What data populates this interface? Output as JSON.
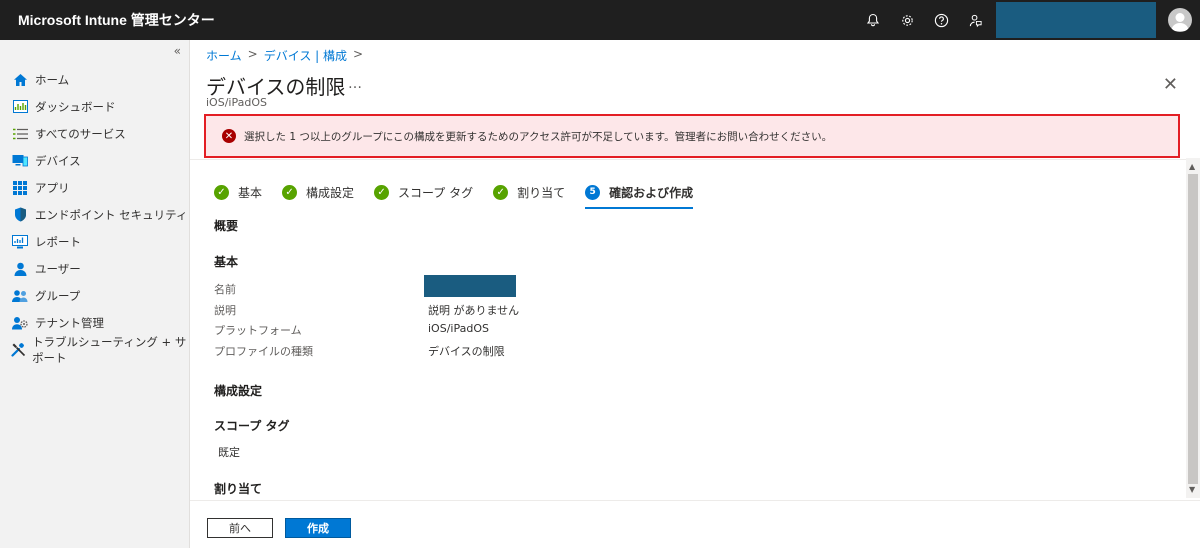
{
  "app": {
    "title": "Microsoft Intune 管理センター"
  },
  "sidebar": {
    "collapse": "«",
    "items": [
      {
        "label": "ホーム",
        "icon": "home-icon"
      },
      {
        "label": "ダッシュボード",
        "icon": "dashboard-icon"
      },
      {
        "label": "すべてのサービス",
        "icon": "list-icon"
      },
      {
        "label": "デバイス",
        "icon": "devices-icon"
      },
      {
        "label": "アプリ",
        "icon": "apps-grid-icon"
      },
      {
        "label": "エンドポイント セキュリティ",
        "icon": "shield-icon"
      },
      {
        "label": "レポート",
        "icon": "reports-icon"
      },
      {
        "label": "ユーザー",
        "icon": "user-icon"
      },
      {
        "label": "グループ",
        "icon": "group-icon"
      },
      {
        "label": "テナント管理",
        "icon": "tenant-admin-icon"
      },
      {
        "label": "トラブルシューティング + サポート",
        "icon": "wrench-icon"
      }
    ]
  },
  "breadcrumb": {
    "items": [
      "ホーム",
      "デバイス | 構成"
    ],
    "separator": ">"
  },
  "page": {
    "title": "デバイスの制限",
    "more": "…",
    "subtitle": "iOS/iPadOS",
    "close": "✕"
  },
  "error": {
    "message": "選択した 1 つ以上のグループにこの構成を更新するためのアクセス許可が不足しています。管理者にお問い合わせください。",
    "icon_glyph": "✕"
  },
  "steps": [
    {
      "label": "基本",
      "state": "done"
    },
    {
      "label": "構成設定",
      "state": "done"
    },
    {
      "label": "スコープ タグ",
      "state": "done"
    },
    {
      "label": "割り当て",
      "state": "done"
    },
    {
      "label": "確認および作成",
      "state": "active",
      "number": "5"
    }
  ],
  "summary": {
    "overview_heading": "概要",
    "basics_heading": "基本",
    "fields": [
      {
        "label": "名前",
        "value": ""
      },
      {
        "label": "説明",
        "value": "説明 がありません"
      },
      {
        "label": "プラットフォーム",
        "value": "iOS/iPadOS"
      },
      {
        "label": "プロファイルの種類",
        "value": "デバイスの制限"
      }
    ],
    "config_heading": "構成設定",
    "scope_heading": "スコープ タグ",
    "scope_value": "既定",
    "assign_heading": "割り当て"
  },
  "footer": {
    "back_label": "前へ",
    "create_label": "作成"
  },
  "colors": {
    "topbar": "#1f1f1f",
    "accent": "#0078d4",
    "success": "#57a300",
    "error_bg": "#fde7e9",
    "error_outline": "#e31e24",
    "redacted": "#1a5c80"
  }
}
